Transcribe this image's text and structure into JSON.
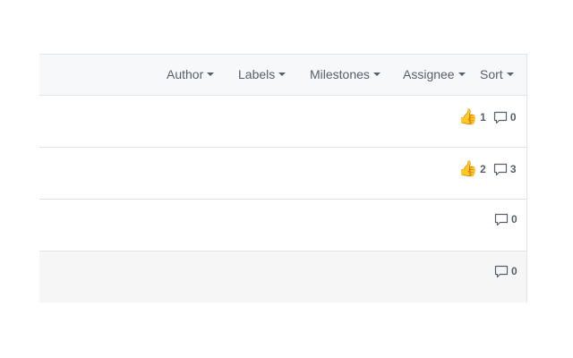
{
  "filters": {
    "author": "Author",
    "labels": "Labels",
    "milestones": "Milestones",
    "assignee": "Assignee",
    "sort": "Sort"
  },
  "rows": [
    {
      "reactions": "1",
      "comments": "0"
    },
    {
      "reactions": "2",
      "comments": "3"
    },
    {
      "comments": "0"
    },
    {
      "comments": "0"
    }
  ],
  "icons": {
    "reaction": "thumbs-up-icon",
    "comment": "comment-icon",
    "dropdown": "caret-down-icon"
  }
}
